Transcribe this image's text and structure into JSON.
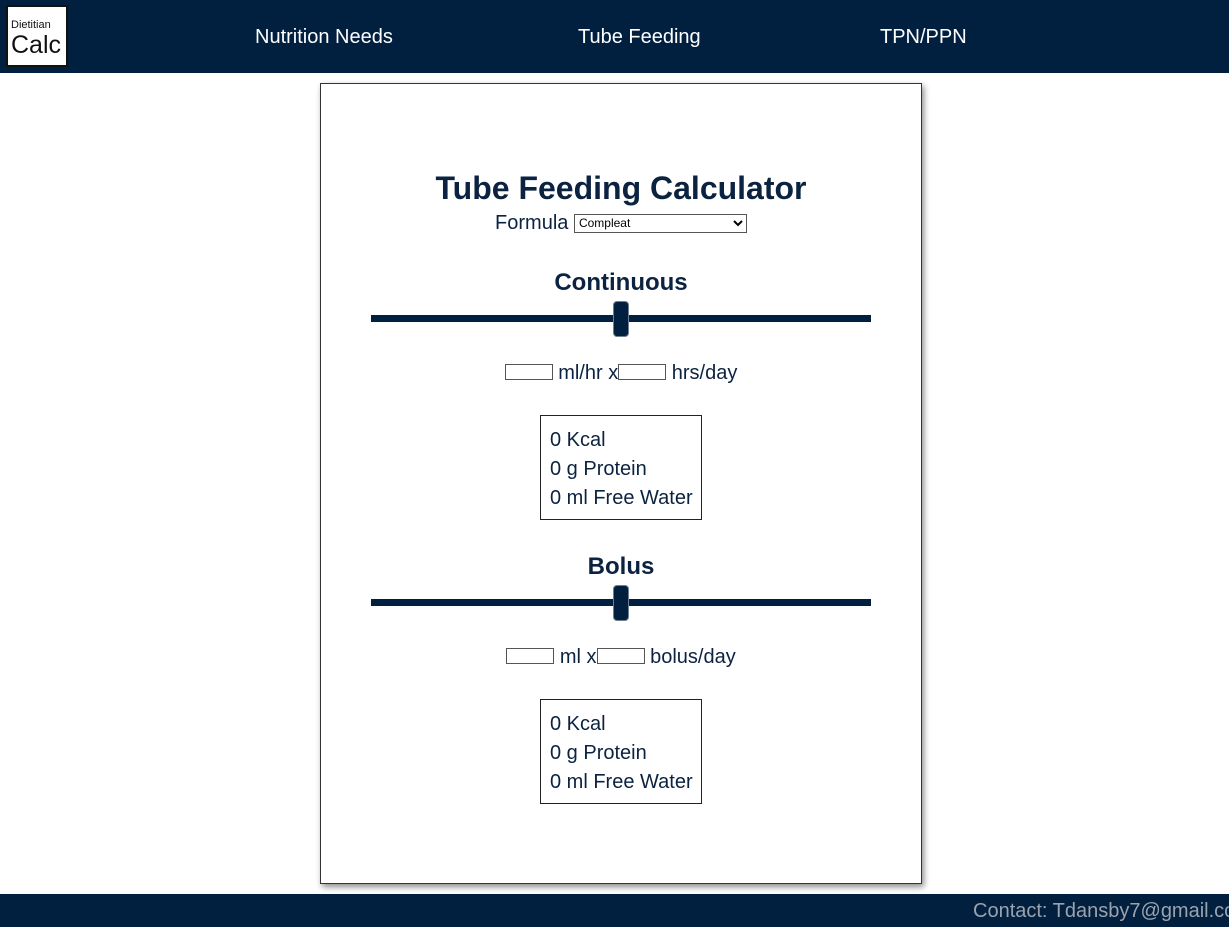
{
  "header": {
    "logo": {
      "line1": "Dietitian",
      "line2": "Calc"
    },
    "nav": [
      {
        "label": "Nutrition Needs"
      },
      {
        "label": "Tube Feeding"
      },
      {
        "label": "TPN/PPN"
      }
    ]
  },
  "main": {
    "title": "Tube Feeding Calculator",
    "formula": {
      "label": "Formula",
      "selected": "Compleat"
    },
    "continuous": {
      "heading": "Continuous",
      "slider_value_fraction": 0.5,
      "rate_unit": "ml/hr x",
      "duration_unit": "hrs/day",
      "results": {
        "kcal": "0 Kcal",
        "protein": "0 g Protein",
        "water": "0 ml Free Water"
      }
    },
    "bolus": {
      "heading": "Bolus",
      "slider_value_fraction": 0.5,
      "volume_unit": "ml x",
      "count_unit": "bolus/day",
      "results": {
        "kcal": "0 Kcal",
        "protein": "0 g Protein",
        "water": "0 ml Free Water"
      }
    }
  },
  "footer": {
    "contact": "Contact: Tdansby7@gmail.co"
  },
  "colors": {
    "navy": "#012040",
    "text": "#0b2240",
    "footer_text": "#9aa3ad"
  }
}
